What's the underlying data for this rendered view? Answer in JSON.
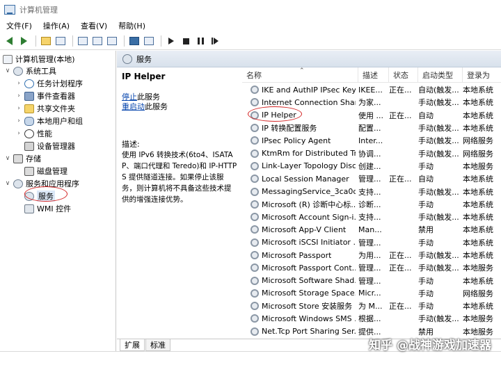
{
  "window": {
    "title": "计算机管理"
  },
  "menubar": [
    "文件(F)",
    "操作(A)",
    "查看(V)",
    "帮助(H)"
  ],
  "tree": {
    "root": "计算机管理(本地)",
    "system_tools": "系统工具",
    "task_scheduler": "任务计划程序",
    "event_viewer": "事件查看器",
    "shared_folders": "共享文件夹",
    "local_users": "本地用户和组",
    "performance": "性能",
    "device_manager": "设备管理器",
    "storage": "存储",
    "disk_management": "磁盘管理",
    "services_apps": "服务和应用程序",
    "services": "服务",
    "wmi": "WMI 控件"
  },
  "pane": {
    "title": "服务"
  },
  "detail": {
    "service_name": "IP Helper",
    "stop_link": "停止",
    "stop_rest": "此服务",
    "restart_link": "重启动",
    "restart_rest": "此服务",
    "desc_label": "描述:",
    "desc_text": "使用 IPv6 转换技术(6to4、ISATAP、端口代理和 Teredo)和 IP-HTTPS 提供隧道连接。如果停止该服务，则计算机将不具备这些技术提供的增强连接优势。"
  },
  "columns": [
    "名称",
    "描述",
    "状态",
    "启动类型",
    "登录为"
  ],
  "services": [
    {
      "name": "IKE and AuthIP IPsec Key...",
      "desc": "IKEE...",
      "status": "正在...",
      "startup": "自动(触发...",
      "logon": "本地系统"
    },
    {
      "name": "Internet Connection Shari...",
      "desc": "为家...",
      "status": "",
      "startup": "手动(触发...",
      "logon": "本地系统"
    },
    {
      "name": "IP Helper",
      "desc": "使用 ...",
      "status": "正在...",
      "startup": "自动",
      "logon": "本地系统"
    },
    {
      "name": "IP 转换配置服务",
      "desc": "配置...",
      "status": "",
      "startup": "手动(触发...",
      "logon": "本地系统"
    },
    {
      "name": "IPsec Policy Agent",
      "desc": "Inter...",
      "status": "",
      "startup": "手动(触发...",
      "logon": "网络服务"
    },
    {
      "name": "KtmRm for Distributed Tr...",
      "desc": "协调...",
      "status": "",
      "startup": "手动(触发...",
      "logon": "网络服务"
    },
    {
      "name": "Link-Layer Topology Disc...",
      "desc": "创建...",
      "status": "",
      "startup": "手动",
      "logon": "本地服务"
    },
    {
      "name": "Local Session Manager",
      "desc": "管理...",
      "status": "正在...",
      "startup": "自动",
      "logon": "本地系统"
    },
    {
      "name": "MessagingService_3ca0d",
      "desc": "支持...",
      "status": "",
      "startup": "手动(触发...",
      "logon": "本地系统"
    },
    {
      "name": "Microsoft (R) 诊断中心标...",
      "desc": "诊断...",
      "status": "",
      "startup": "手动",
      "logon": "本地系统"
    },
    {
      "name": "Microsoft Account Sign-i...",
      "desc": "支持...",
      "status": "",
      "startup": "手动(触发...",
      "logon": "本地系统"
    },
    {
      "name": "Microsoft App-V Client",
      "desc": "Man...",
      "status": "",
      "startup": "禁用",
      "logon": "本地系统"
    },
    {
      "name": "Microsoft iSCSI Initiator ...",
      "desc": "管理...",
      "status": "",
      "startup": "手动",
      "logon": "本地系统"
    },
    {
      "name": "Microsoft Passport",
      "desc": "为用...",
      "status": "正在...",
      "startup": "手动(触发...",
      "logon": "本地系统"
    },
    {
      "name": "Microsoft Passport Cont...",
      "desc": "管理...",
      "status": "正在...",
      "startup": "手动(触发...",
      "logon": "本地服务"
    },
    {
      "name": "Microsoft Software Shad...",
      "desc": "管理...",
      "status": "",
      "startup": "手动",
      "logon": "本地系统"
    },
    {
      "name": "Microsoft Storage Space...",
      "desc": "Micr...",
      "status": "",
      "startup": "手动",
      "logon": "网络服务"
    },
    {
      "name": "Microsoft Store 安装服务",
      "desc": "为 M...",
      "status": "正在...",
      "startup": "手动",
      "logon": "本地系统"
    },
    {
      "name": "Microsoft Windows SMS ...",
      "desc": "根据...",
      "status": "",
      "startup": "手动(触发...",
      "logon": "本地服务"
    },
    {
      "name": "Net.Tcp Port Sharing Ser...",
      "desc": "提供...",
      "status": "",
      "startup": "禁用",
      "logon": "本地服务"
    }
  ],
  "tabs": [
    "扩展",
    "标准"
  ],
  "watermark": "知乎 @战神游戏加速器"
}
